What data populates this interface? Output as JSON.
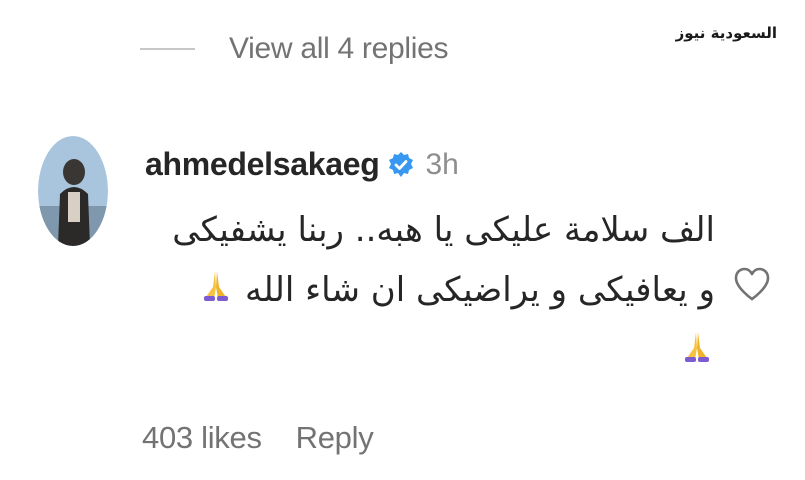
{
  "watermark": "السعودية نيوز",
  "thread": {
    "view_replies_label": "View all 4 replies"
  },
  "comment": {
    "username": "ahmedelsakaeg",
    "verified": true,
    "time": "3h",
    "line1": "الف سلامة عليكى يا هبه.. ربنا يشفيكى",
    "line2": "و يعافيكى و يراضيكى ان شاء الله",
    "emoji": "folded-hands",
    "likes_label": "403 likes",
    "reply_label": "Reply"
  },
  "icons": {
    "heart": "heart-outline-icon",
    "verified": "verified-badge-icon"
  },
  "colors": {
    "verified_blue": "#3897f0",
    "muted_text": "#737373",
    "pray_emoji": "#f5c242"
  }
}
